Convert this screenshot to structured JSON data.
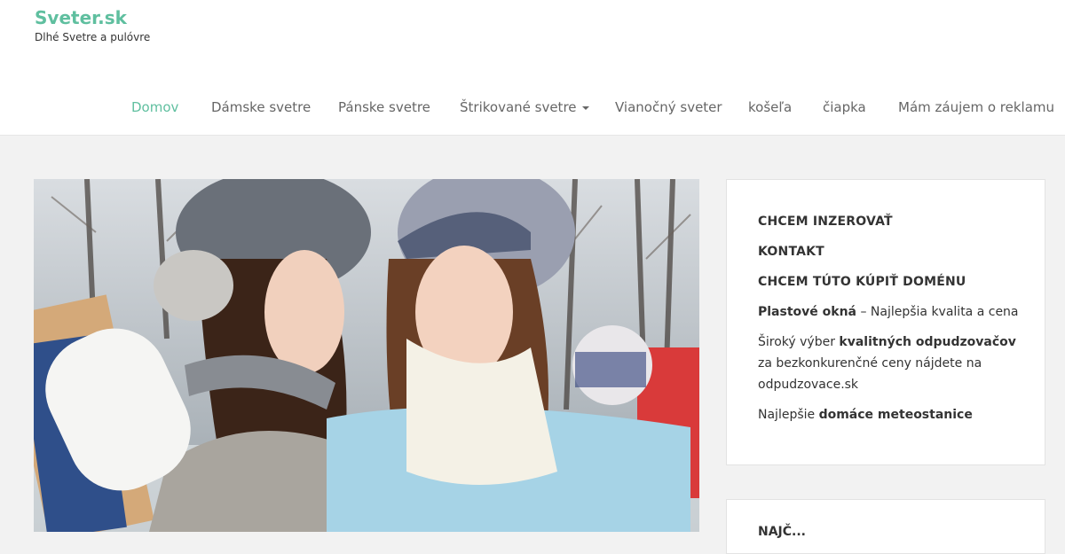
{
  "site": {
    "title": "Sveter.sk",
    "tagline": "Dlhé Svetre a pulóvre"
  },
  "nav": {
    "items": [
      {
        "label": "Domov",
        "active": true
      },
      {
        "label": "Dámske svetre"
      },
      {
        "label": "Pánske svetre"
      },
      {
        "label": "Štrikované svetre"
      },
      {
        "label": "Vianočný sveter"
      },
      {
        "label": "košeľa"
      },
      {
        "label": "čiapka"
      },
      {
        "label": "Mám záujem o reklamu"
      }
    ]
  },
  "sidebar": {
    "links": [
      {
        "label": "CHCEM INZEROVAŤ"
      },
      {
        "label": "KONTAKT"
      },
      {
        "label": "CHCEM TÚTO KÚPIŤ DOMÉNU"
      }
    ],
    "ad1": {
      "link": "Plastové okná",
      "text": " – Najlepšia kvalita a cena"
    },
    "ad2": {
      "prefix": "Široký výber ",
      "link": "kvalitných odpudzovačov",
      "line2": "za bezkonkurenčné ceny nájdete na",
      "line3": "odpudzovace.sk"
    },
    "ad3": {
      "prefix": "Najlepšie ",
      "link": "domáce meteostanice"
    },
    "next_box_partial": "NAJČ..."
  },
  "hero": {
    "image": "two women in winter hats and scarves with shopping bags"
  },
  "colors": {
    "accent": "#5fbf9f",
    "background": "#f2f2f2"
  }
}
